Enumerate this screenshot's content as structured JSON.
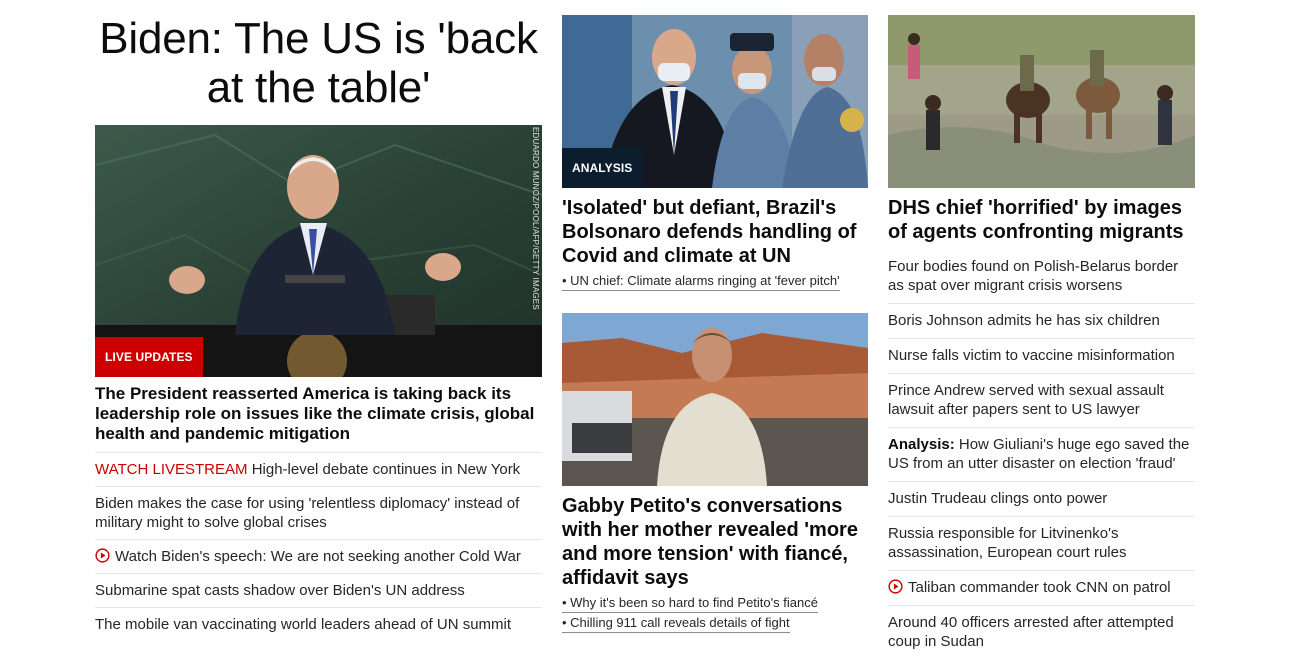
{
  "left": {
    "headline": "Biden: The US is 'back at the table'",
    "photo_credit": "EDUARDO MUNOZ/POOL/AFP/GETTY IMAGES",
    "badge": "LIVE UPDATES",
    "summary": "The President reasserted America is taking back its leadership role on issues like the climate crisis, global health and pandemic mitigation",
    "items": [
      {
        "prefix": "WATCH LIVESTREAM",
        "text": "High-level debate continues in New York"
      },
      {
        "text": "Biden makes the case for using 'relentless diplomacy' instead of military might to solve global crises"
      },
      {
        "icon": "play-icon",
        "text": "Watch Biden's speech: We are not seeking another Cold War"
      },
      {
        "text": "Submarine spat casts shadow over Biden's UN address"
      },
      {
        "text": "The mobile van vaccinating world leaders ahead of UN summit"
      }
    ]
  },
  "middle": {
    "story1": {
      "badge": "ANALYSIS",
      "title": "'Isolated' but defiant, Brazil's Bolsonaro defends handling of Covid and climate at UN",
      "related": [
        "• UN chief: Climate alarms ringing at 'fever pitch'"
      ]
    },
    "story2": {
      "title": "Gabby Petito's conversations with her mother revealed 'more and more tension' with fiancé, affidavit says",
      "related": [
        "• Why it's been so hard to find Petito's fiancé",
        "• Chilling 911 call reveals details of fight"
      ]
    }
  },
  "right": {
    "title": "DHS chief 'horrified' by images of agents confronting migrants",
    "items": [
      {
        "text": "Four bodies found on Polish-Belarus border as spat over migrant crisis worsens"
      },
      {
        "text": "Boris Johnson admits he has six children"
      },
      {
        "text": "Nurse falls victim to vaccine misinformation"
      },
      {
        "text": "Prince Andrew served with sexual assault lawsuit after papers sent to US lawyer"
      },
      {
        "prefix": "Analysis:",
        "text": "How Giuliani's huge ego saved the US from an utter disaster on election 'fraud'"
      },
      {
        "text": "Justin Trudeau clings onto power"
      },
      {
        "text": "Russia responsible for Litvinenko's assassination, European court rules"
      },
      {
        "icon": "play-icon",
        "text": "Taliban commander took CNN on patrol"
      },
      {
        "text": "Around 40 officers arrested after attempted coup in Sudan"
      }
    ]
  },
  "colors": {
    "accent_red": "#cc0000",
    "analysis_badge": "#0c1d2d",
    "divider": "#e6e6e6"
  }
}
